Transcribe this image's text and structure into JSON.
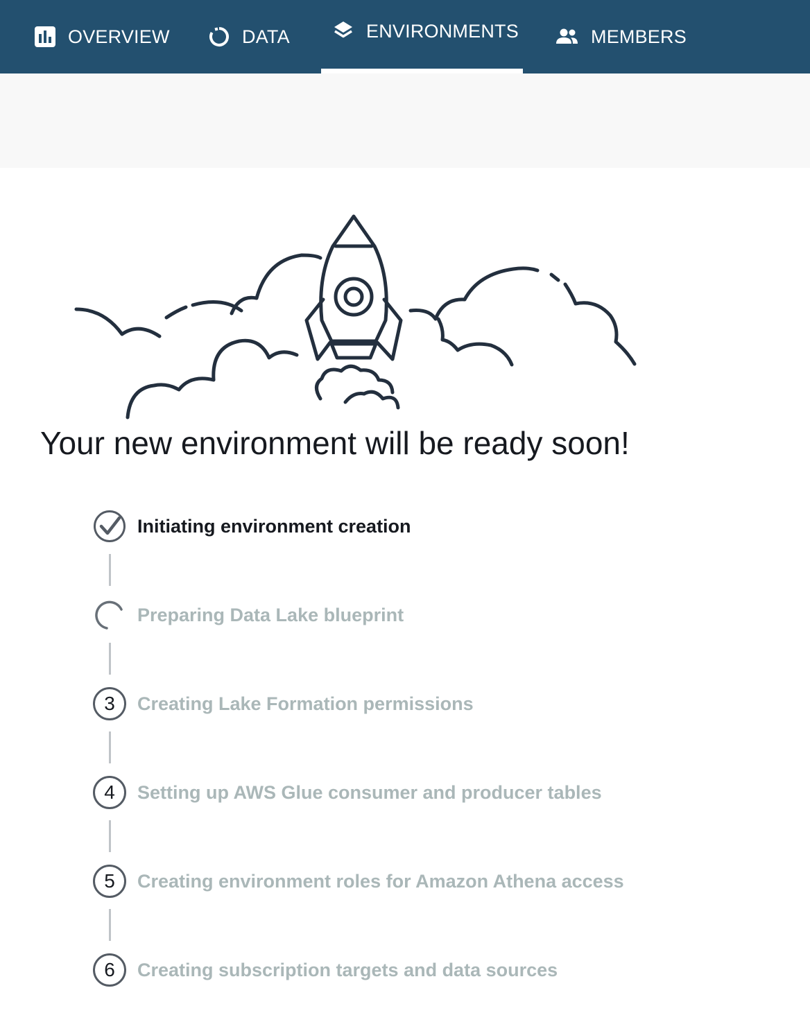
{
  "nav": {
    "tabs": [
      {
        "label": "OVERVIEW",
        "icon": "bar-chart-icon",
        "active": false
      },
      {
        "label": "DATA",
        "icon": "circle-arrow-icon",
        "active": false
      },
      {
        "label": "ENVIRONMENTS",
        "icon": "layers-icon",
        "active": true
      },
      {
        "label": "MEMBERS",
        "icon": "users-icon",
        "active": false
      }
    ]
  },
  "main": {
    "headline": "Your new environment will be ready soon!",
    "steps": [
      {
        "status": "completed",
        "icon": "check-circle-icon",
        "label": "Initiating environment creation"
      },
      {
        "status": "in-progress",
        "icon": "spinner-icon",
        "label": "Preparing Data Lake blueprint"
      },
      {
        "status": "pending",
        "number": "3",
        "label": "Creating Lake Formation permissions"
      },
      {
        "status": "pending",
        "number": "4",
        "label": "Setting up AWS Glue consumer and producer tables"
      },
      {
        "status": "pending",
        "number": "5",
        "label": "Creating environment roles for Amazon Athena access"
      },
      {
        "status": "pending",
        "number": "6",
        "label": "Creating subscription targets and data sources"
      }
    ]
  },
  "colors": {
    "nav_background": "#23506f",
    "text_primary": "#16191f",
    "text_pending": "#aab7b8",
    "illustration_stroke": "#232f3e"
  }
}
